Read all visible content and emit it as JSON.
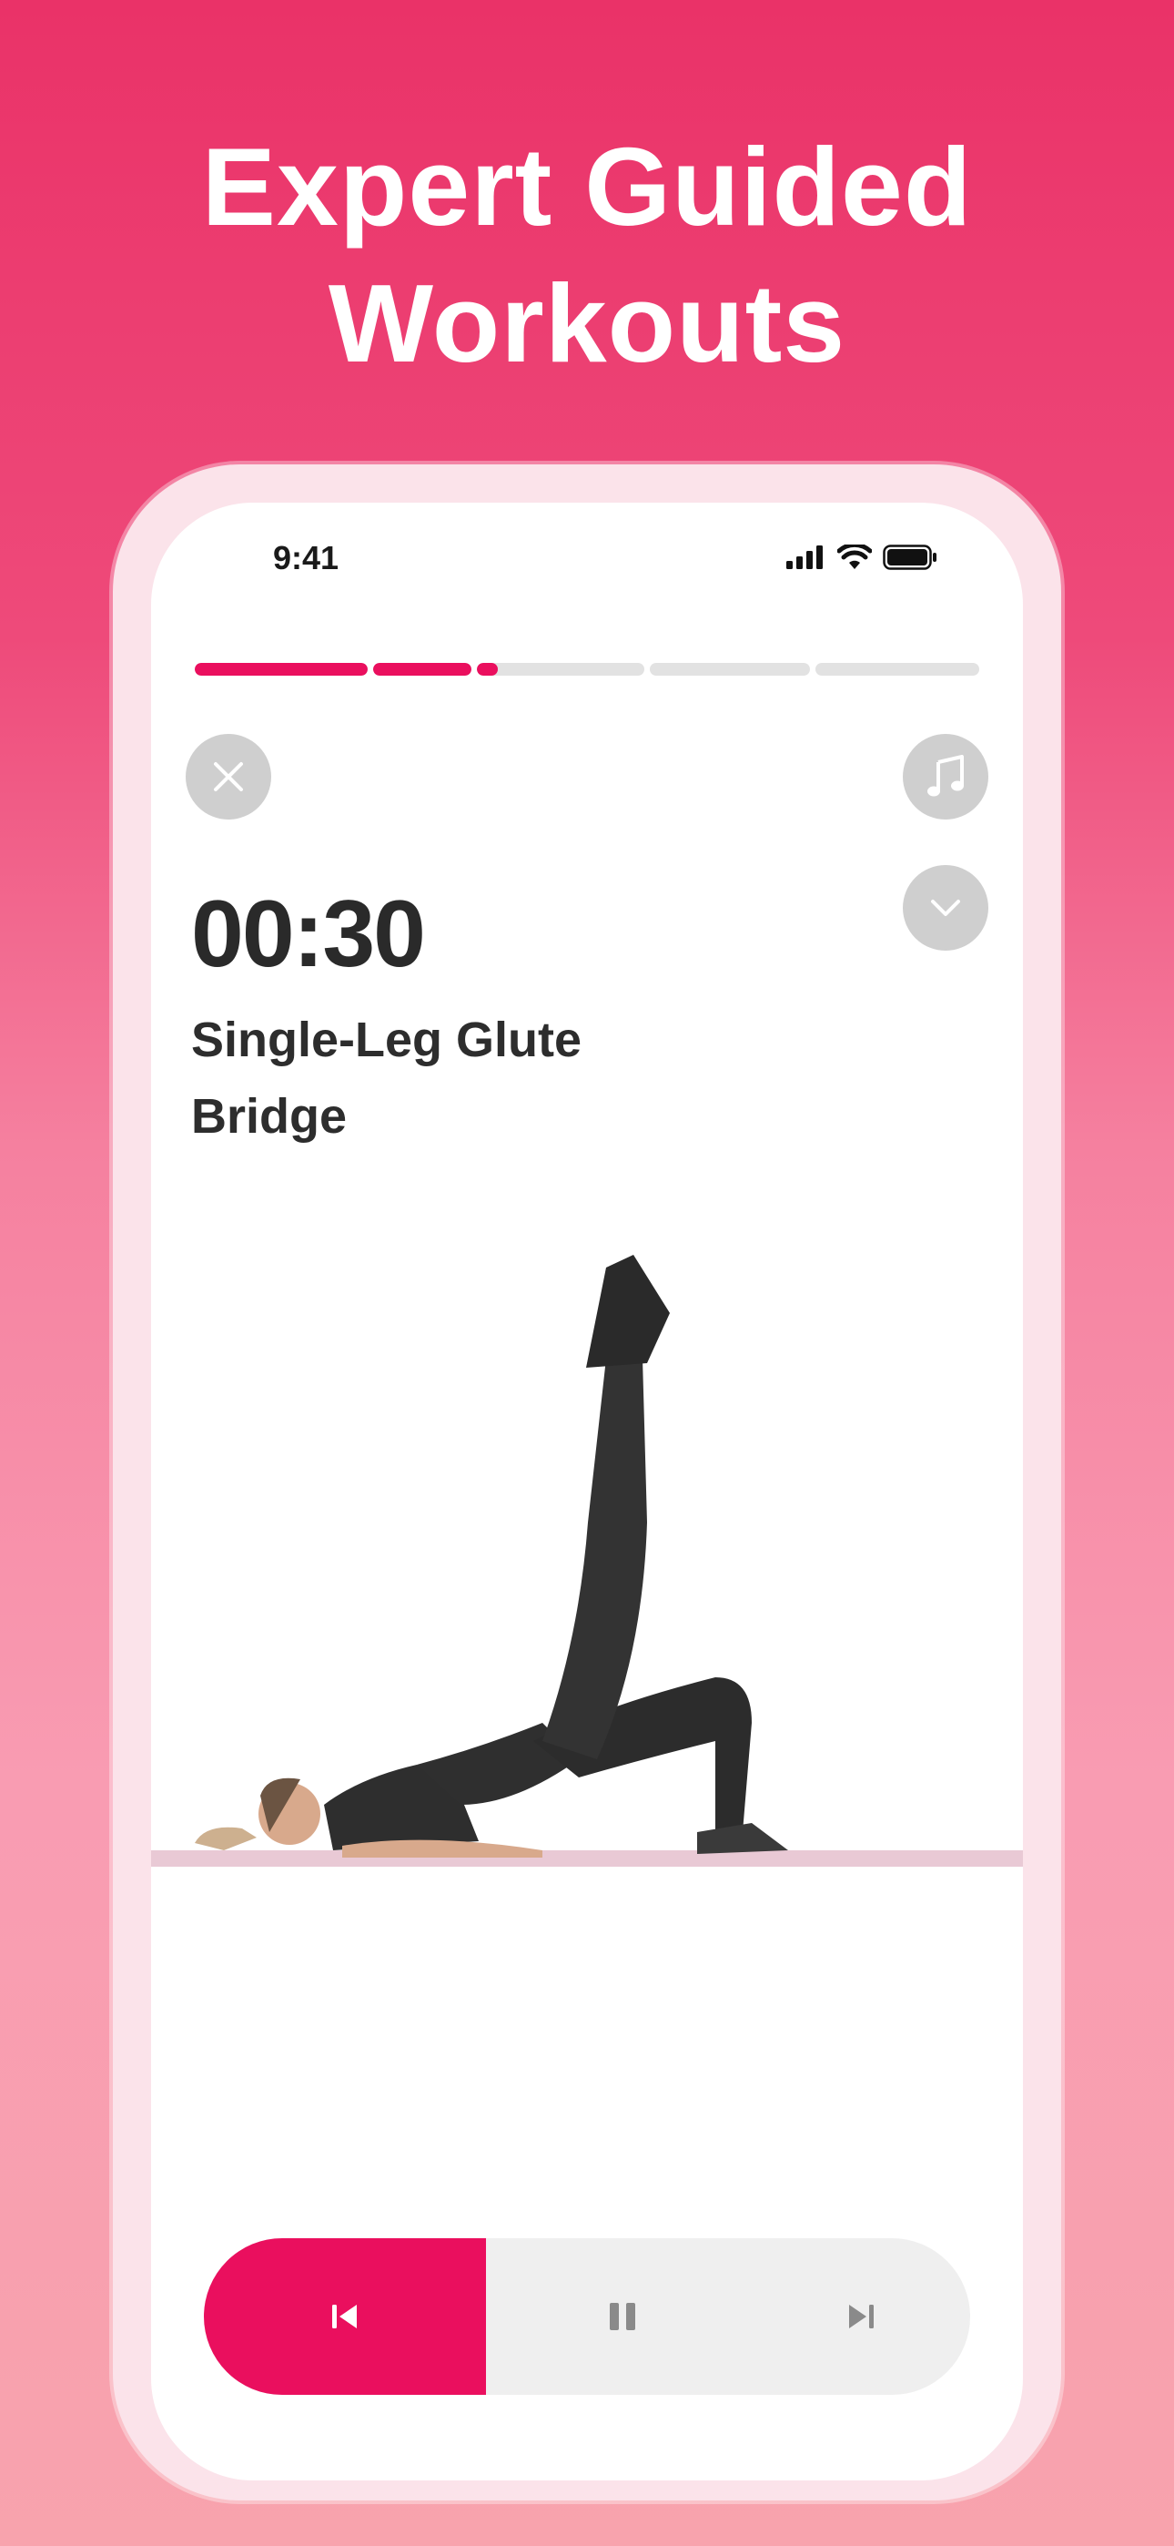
{
  "promo": {
    "headline_line1": "Expert Guided",
    "headline_line2": "Workouts"
  },
  "status_bar": {
    "time": "9:41",
    "icons": [
      "signal-icon",
      "wifi-icon",
      "battery-icon"
    ]
  },
  "progress": {
    "segments": [
      1.0,
      1.0,
      0.35,
      0.0,
      0.0,
      0.0
    ],
    "accent_color": "#ea0f5e",
    "track_color": "#e2e2e2"
  },
  "top_buttons": {
    "close_icon": "close-icon",
    "music_icon": "music-note-icon",
    "collapse_icon": "chevron-down-icon"
  },
  "workout": {
    "timer": "00:30",
    "exercise_line1": "Single-Leg Glute",
    "exercise_line2": "Bridge"
  },
  "controls": {
    "prev_icon": "skip-previous-icon",
    "pause_icon": "pause-icon",
    "next_icon": "skip-next-icon"
  },
  "colors": {
    "brand": "#ea0f5e",
    "background_top": "#ea3268",
    "background_bottom": "#f8a3ad"
  }
}
